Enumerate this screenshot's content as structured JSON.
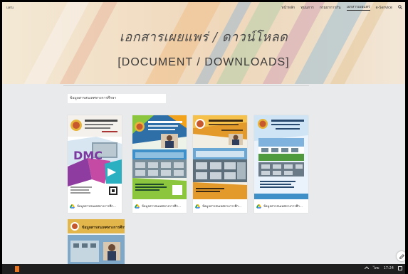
{
  "site": {
    "name": "แดน"
  },
  "nav": {
    "items": [
      "หน้าหลัก",
      "ทุนนการ",
      "กรมยาการกัน",
      "เอกสารเผยแพร่",
      "e-Service"
    ],
    "active_index": 3
  },
  "hero": {
    "title_th": "เอกสารเผยแพร่ / ดาวน์โหลด",
    "title_en": "[DOCUMENT / DOWNLOADS]"
  },
  "section": {
    "heading": "ข้อมูลสารสนเทศทางการศึกษา"
  },
  "cards": [
    {
      "caption": "ข้อมูลสารสนเทศทางการศึก..."
    },
    {
      "caption": "ข้อมูลสารสนเทศทางการศึก..."
    },
    {
      "caption": "ข้อมูลสารสนเทศทางการศึก..."
    },
    {
      "caption": "ข้อมูลสารสนเทศทางการศึก..."
    }
  ],
  "cover_text": {
    "dmc": "DMC",
    "c5_title": "ข้อมูลสารสนเทศทางการศึกษา"
  },
  "taskbar": {
    "lang": "ไทย",
    "time": "17:24"
  },
  "colors": {
    "accent": "#e8741f",
    "taskbar": "#1f1f1f",
    "page_bg": "#e9eaeb"
  },
  "icons": {
    "search": "search-icon",
    "drive": "google-drive-icon",
    "edit": "edit-pencil-icon"
  }
}
